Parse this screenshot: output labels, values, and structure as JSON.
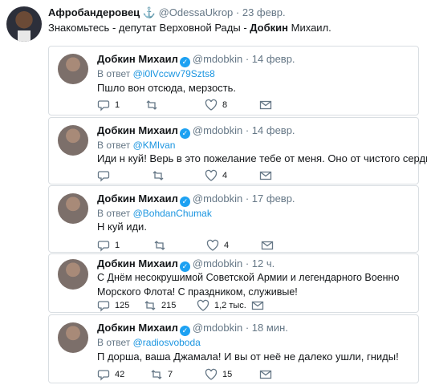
{
  "header": {
    "name": "Афробандеровец",
    "anchor": "⚓",
    "handle": "@OdessaUkrop",
    "date": "· 23 февр.",
    "text_pre": "Знакомьтесь - депутат Верховной Рады - ",
    "text_bold": "Добкин",
    "text_post": " Михаил."
  },
  "quotes": [
    {
      "name": "Добкин Михаил",
      "handle": "@mdobkin",
      "date": "· 14 февр.",
      "reply_prefix": "В ответ ",
      "reply_to": "@i0lVccwv79Szts8",
      "text": "Пшло вон отсюда, мерзость.",
      "replies": "1",
      "retweets": "",
      "likes": "8"
    },
    {
      "name": "Добкин Михаил",
      "handle": "@mdobkin",
      "date": "· 14 февр.",
      "reply_prefix": "В ответ ",
      "reply_to": "@KMIvan",
      "text": "Иди н  куй! Верь в это пожелание тебе от меня. Оно от чистого сердца.",
      "replies": "",
      "retweets": "",
      "likes": "4"
    },
    {
      "name": "Добкин Михаил",
      "handle": "@mdobkin",
      "date": "· 17 февр.",
      "reply_prefix": "В ответ ",
      "reply_to": "@BohdanChumak",
      "text": "Н  куй иди.",
      "replies": "1",
      "retweets": "",
      "likes": "4"
    },
    {
      "name": "Добкин Михаил",
      "handle": "@mdobkin",
      "date": "· 12 ч.",
      "reply_prefix": "",
      "reply_to": "",
      "text": "С Днём несокрушимой Советской Армии и легендарного Военно Морского Флота! С праздником, служивые!",
      "replies": "125",
      "retweets": "215",
      "likes": "1,2 тыс."
    },
    {
      "name": "Добкин Михаил",
      "handle": "@mdobkin",
      "date": "· 18 мин.",
      "reply_prefix": "В ответ ",
      "reply_to": "@radiosvoboda",
      "text": "П  дорша, ваша Джамала! И вы от неё не далеко ушли, гниды!",
      "replies": "42",
      "retweets": "7",
      "likes": "15"
    }
  ],
  "colors": {
    "link": "#1b95e0",
    "muted": "#657786",
    "border": "#d9dee2",
    "verified": "#1da1f2"
  }
}
